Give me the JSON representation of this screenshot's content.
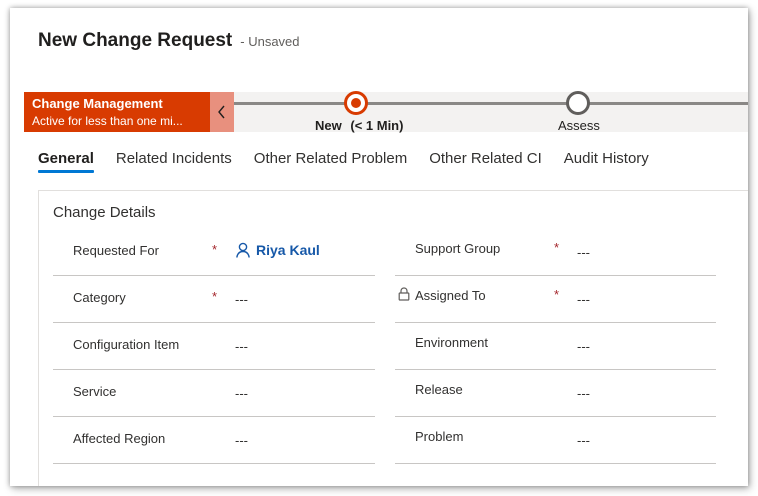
{
  "header": {
    "title": "New Change Request",
    "status": "- Unsaved"
  },
  "process": {
    "active_stage": {
      "name": "Change Management",
      "duration": "Active for less than one mi..."
    },
    "collapse_icon": "chevron-left-icon",
    "stages": [
      {
        "label": "New",
        "duration": "(< 1 Min)"
      },
      {
        "label": "Assess"
      }
    ],
    "colors": {
      "active": "#d83b01",
      "collapse": "#e8907e",
      "bar": "#f3f2f1"
    }
  },
  "tabs": [
    "General",
    "Related Incidents",
    "Other Related Problem",
    "Other Related CI",
    "Audit History"
  ],
  "section": {
    "title": "Change Details",
    "left": [
      {
        "label": "Requested For",
        "required": "*",
        "value": "Riya Kaul",
        "icon": "person-icon"
      },
      {
        "label": "Category",
        "required": "*",
        "value": "---"
      },
      {
        "label": "Configuration Item",
        "value": "---"
      },
      {
        "label": "Service",
        "value": "---"
      },
      {
        "label": "Affected Region",
        "value": "---"
      }
    ],
    "right": [
      {
        "label": "Support Group",
        "required": "*",
        "value": "---"
      },
      {
        "label": "Assigned To",
        "required": "*",
        "value": "---",
        "icon": "lock-icon"
      },
      {
        "label": "Environment",
        "value": "---"
      },
      {
        "label": "Release",
        "value": "---"
      },
      {
        "label": "Problem",
        "value": "---"
      }
    ]
  }
}
